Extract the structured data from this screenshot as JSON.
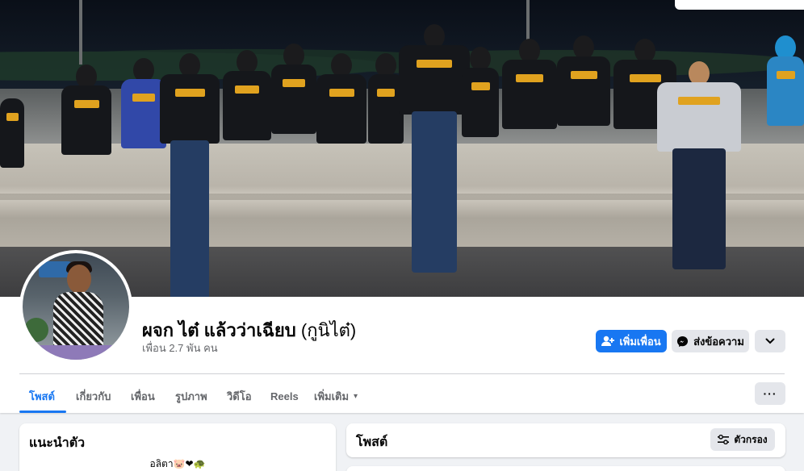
{
  "profile": {
    "name": "ผจก ไต๋ แล้วว่าเฉียบ",
    "alt_name": "(กูนิไต๋)",
    "friends": "เพื่อน 2.7 พัน คน"
  },
  "actions": {
    "add_friend": "เพิ่มเพื่อน",
    "message": "ส่งข้อความ"
  },
  "tabs": [
    {
      "label": "โพสต์",
      "active": true
    },
    {
      "label": "เกี่ยวกับ"
    },
    {
      "label": "เพื่อน"
    },
    {
      "label": "รูปภาพ"
    },
    {
      "label": "วิดีโอ"
    },
    {
      "label": "Reels"
    },
    {
      "label": "เพิ่มเติม"
    }
  ],
  "more_tab_caret": "▾",
  "dots_label": "···",
  "intro": {
    "title": "แนะนำตัว",
    "bio": "อลิตา🐷❤🐢"
  },
  "posts": {
    "title": "โพสต์",
    "filter": "ตัวกรอง"
  },
  "colors": {
    "accent": "#1877f2",
    "secondary_button": "#e4e6eb",
    "page_bg": "#f0f2f5"
  },
  "icons": {
    "add_friend": "person-plus-icon",
    "message": "messenger-icon",
    "more": "chevron-down-icon",
    "filter": "sliders-icon",
    "dots": "more-dots-icon"
  }
}
